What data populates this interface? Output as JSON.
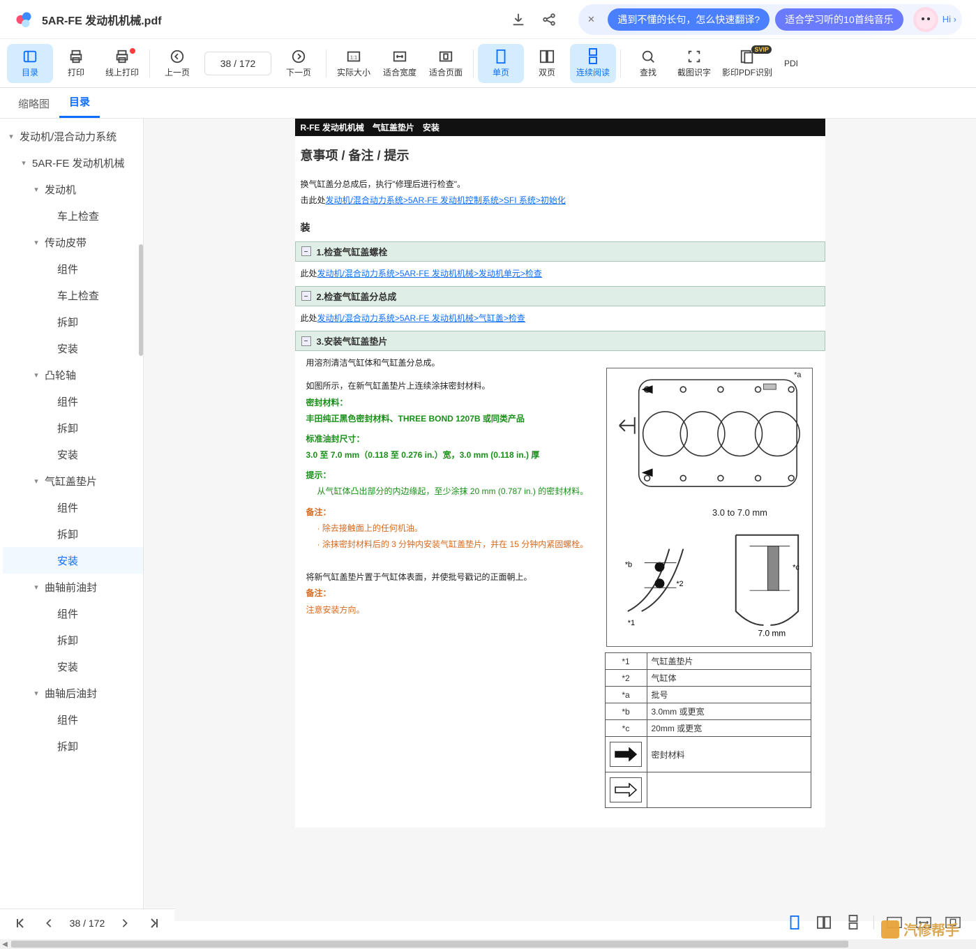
{
  "file_name": "5AR-FE 发动机机械.pdf",
  "promo": {
    "pill1": "遇到不懂的长句，怎么快速翻译?",
    "pill2": "适合学习听的10首纯音乐",
    "hi": "Hi"
  },
  "toolbar": {
    "outline": "目录",
    "print": "打印",
    "online_print": "线上打印",
    "prev_page": "上一页",
    "page_indicator": "38  / 172",
    "next_page": "下一页",
    "actual_size": "实际大小",
    "fit_width": "适合宽度",
    "fit_page": "适合页面",
    "single": "单页",
    "double": "双页",
    "continuous": "连续阅读",
    "find": "查找",
    "ocr_crop": "截图识字",
    "ocr_pdf": "影印PDF识别",
    "pdf_more": "PDI"
  },
  "side_tabs": {
    "thumb": "缩略图",
    "outline": "目录"
  },
  "tree": [
    {
      "lvl": 1,
      "label": "发动机/混合动力系统",
      "caret": true
    },
    {
      "lvl": 2,
      "label": "5AR-FE 发动机机械",
      "caret": true
    },
    {
      "lvl": 3,
      "label": "发动机",
      "caret": true
    },
    {
      "lvl": 4,
      "label": "车上检查"
    },
    {
      "lvl": 3,
      "label": "传动皮带",
      "caret": true
    },
    {
      "lvl": 4,
      "label": "组件"
    },
    {
      "lvl": 4,
      "label": "车上检查"
    },
    {
      "lvl": 4,
      "label": "拆卸"
    },
    {
      "lvl": 4,
      "label": "安装"
    },
    {
      "lvl": 3,
      "label": "凸轮轴",
      "caret": true
    },
    {
      "lvl": 4,
      "label": "组件"
    },
    {
      "lvl": 4,
      "label": "拆卸"
    },
    {
      "lvl": 4,
      "label": "安装"
    },
    {
      "lvl": 3,
      "label": "气缸盖垫片",
      "caret": true
    },
    {
      "lvl": 4,
      "label": "组件"
    },
    {
      "lvl": 4,
      "label": "拆卸"
    },
    {
      "lvl": 4,
      "label": "安装",
      "active": true
    },
    {
      "lvl": 3,
      "label": "曲轴前油封",
      "caret": true
    },
    {
      "lvl": 4,
      "label": "组件"
    },
    {
      "lvl": 4,
      "label": "拆卸"
    },
    {
      "lvl": 4,
      "label": "安装"
    },
    {
      "lvl": 3,
      "label": "曲轴后油封",
      "caret": true
    },
    {
      "lvl": 4,
      "label": "组件"
    },
    {
      "lvl": 4,
      "label": "拆卸"
    }
  ],
  "doc": {
    "strip": "R-FE 发动机机械　气缸盖垫片　安装",
    "heading": "意事项 / 备注 / 提示",
    "intro1": "换气缸盖分总成后，执行\"修理后进行检查\"。",
    "intro2_prefix": "击此处",
    "intro2_link": "发动机/混合动力系统>5AR-FE 发动机控制系统>SFI 系统>初始化",
    "section_lbl": "装",
    "steps": [
      {
        "title": "1.检查气缸盖螺栓",
        "ref_prefix": "此处",
        "ref": "发动机/混合动力系统>5AR-FE 发动机机械>发动机单元>检查"
      },
      {
        "title": "2.检查气缸盖分总成",
        "ref_prefix": "此处",
        "ref": "发动机/混合动力系统>5AR-FE 发动机机械>气缸盖>检查"
      },
      {
        "title": "3.安装气缸盖垫片"
      }
    ],
    "body": [
      "用溶剂清洁气缸体和气缸盖分总成。",
      "如图所示，在新气缸盖垫片上连续涂抹密封材料。"
    ],
    "seal_label": "密封材料：",
    "seal_text": "丰田纯正黑色密封材料、THREE BOND 1207B 或同类产品",
    "dim_label": "标准油封尺寸：",
    "dim_text": "3.0 至 7.0 mm（0.118 至 0.276 in.）宽，3.0 mm (0.118 in.) 厚",
    "hint_label": "提示：",
    "hint_text": "从气缸体凸出部分的内边缘起，至少涂抹 20 mm (0.787 in.) 的密封材料。",
    "note_label": "备注：",
    "note_items": [
      "除去接触面上的任何机油。",
      "涂抹密封材料后的 3 分钟内安装气缸盖垫片，并在 15 分钟内紧固螺栓。"
    ],
    "place_text": "将新气缸盖垫片置于气缸体表面，并使批号戳记的正面朝上。",
    "note2_label": "备注：",
    "note2_text": "注意安装方向。",
    "fig_labels": {
      "range": "3.0 to 7.0 mm",
      "a": "*a",
      "b": "*b",
      "c": "*c",
      "one": "*1",
      "two": "*2",
      "width": "7.0 mm"
    },
    "spec_rows": [
      {
        "k": "*1",
        "v": "气缸盖垫片"
      },
      {
        "k": "*2",
        "v": "气缸体"
      },
      {
        "k": "*a",
        "v": "批号"
      },
      {
        "k": "*b",
        "v": "3.0mm 或更宽"
      },
      {
        "k": "*c",
        "v": "20mm 或更宽"
      }
    ],
    "spec_arrow_label": "密封材料"
  },
  "bottom": {
    "page": "38  / 172"
  },
  "watermark": "汽修帮手"
}
